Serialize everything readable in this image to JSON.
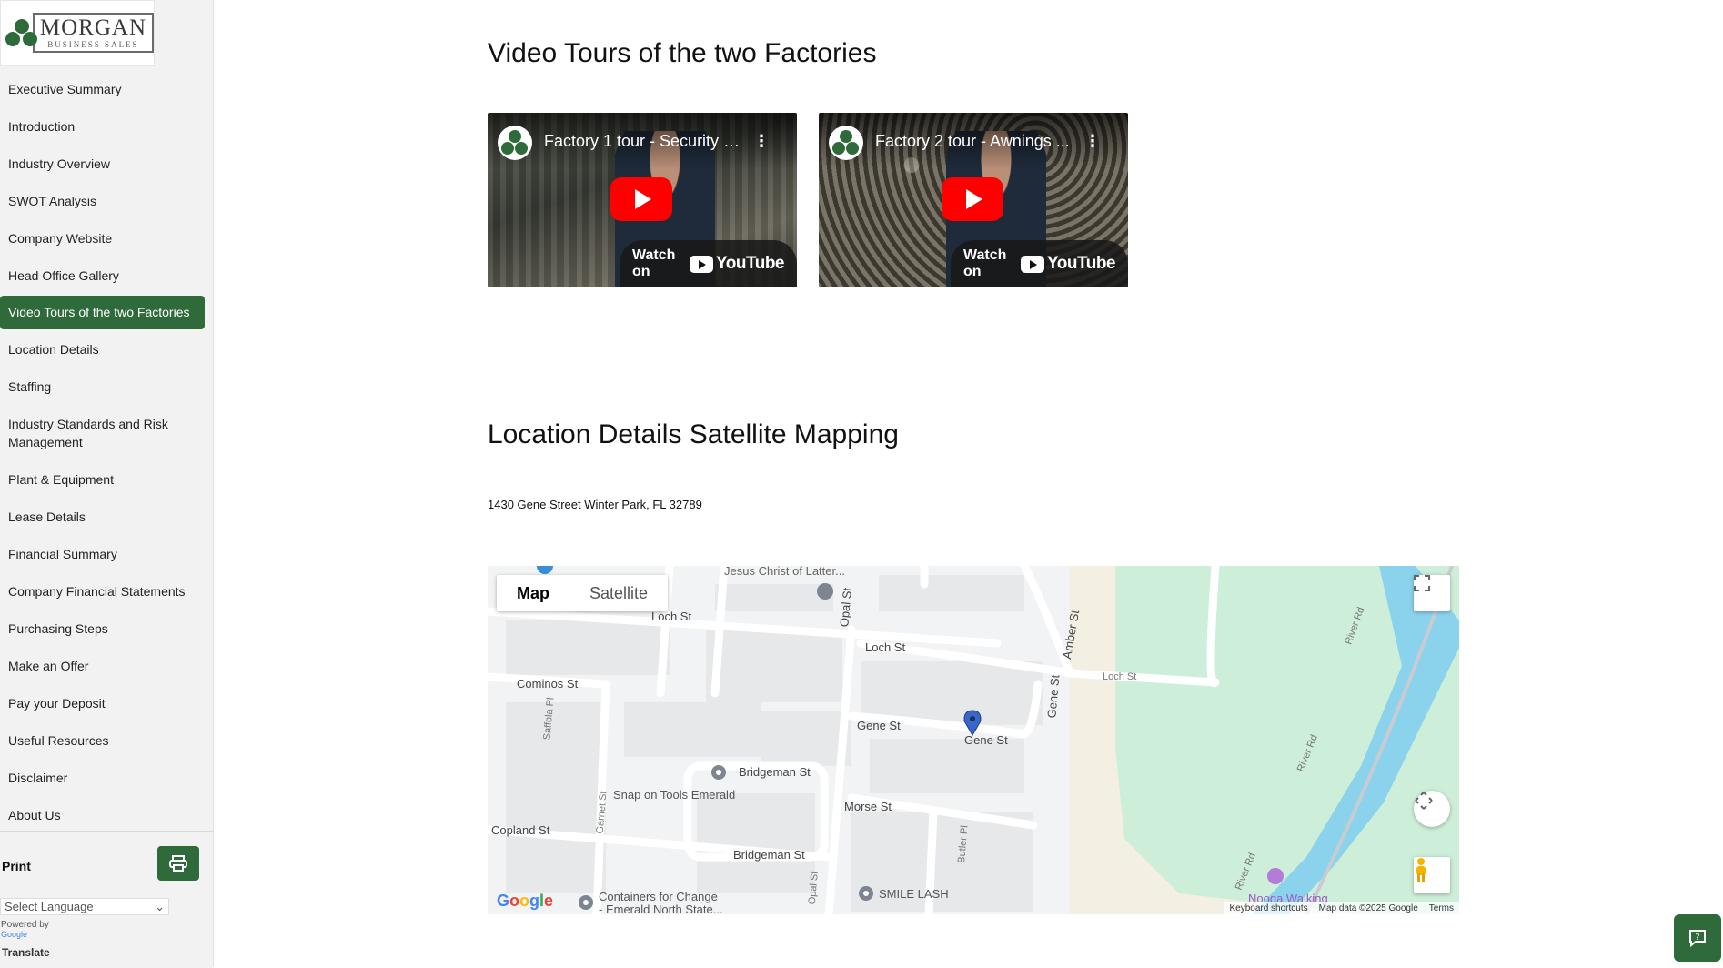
{
  "logo": {
    "title": "MORGAN",
    "subtitle": "BUSINESS SALES"
  },
  "sidebar": {
    "items": [
      {
        "label": "Executive Summary"
      },
      {
        "label": "Introduction"
      },
      {
        "label": "Industry Overview"
      },
      {
        "label": "SWOT Analysis"
      },
      {
        "label": "Company Website"
      },
      {
        "label": "Head Office Gallery"
      },
      {
        "label": "Video Tours of the two Factories"
      },
      {
        "label": "Location Details"
      },
      {
        "label": "Staffing"
      },
      {
        "label": "Industry Standards and Risk Management"
      },
      {
        "label": "Plant & Equipment"
      },
      {
        "label": "Lease Details"
      },
      {
        "label": "Financial Summary"
      },
      {
        "label": "Company Financial Statements"
      },
      {
        "label": "Purchasing Steps"
      },
      {
        "label": "Make an Offer"
      },
      {
        "label": "Pay your Deposit"
      },
      {
        "label": "Useful Resources"
      },
      {
        "label": "Disclaimer"
      },
      {
        "label": "About Us"
      }
    ],
    "active_index": 6,
    "print_label": "Print",
    "language_select": "Select Language",
    "powered_by": "Powered by",
    "google_label": "Google",
    "translate_label": "Translate"
  },
  "video_section": {
    "title": "Video Tours of the two Factories",
    "videos": [
      {
        "title": "Factory 1 tour - Security S...",
        "watch_label": "Watch on",
        "platform": "YouTube"
      },
      {
        "title": "Factory 2 tour - Awnings ...",
        "watch_label": "Watch on",
        "platform": "YouTube"
      }
    ]
  },
  "location_section": {
    "title": "Location Details Satellite Mapping",
    "address": "1430 Gene Street Winter Park, FL 32789"
  },
  "map": {
    "map_tab": "Map",
    "satellite_tab": "Satellite",
    "streets": [
      "Jesus Christ of Latter...",
      "Loch St",
      "Loch St",
      "Loch St",
      "Cominos St",
      "Gene St",
      "Gene St",
      "Gene St",
      "Bridgeman St",
      "Snap on Tools Emerald",
      "Morse St",
      "Copland St",
      "Bridgeman St",
      "Containers for Change",
      "- Emerald North State...",
      "SMILE LASH",
      "Opal St",
      "Amber St",
      "Saffola Pl",
      "Garnet St",
      "Butler Pl",
      "River Rd",
      "River Rd",
      "River Rd",
      "Nooga Walking",
      "Opal St"
    ],
    "footer": {
      "shortcuts": "Keyboard shortcuts",
      "data": "Map data ©2025 Google",
      "terms": "Terms"
    },
    "google_logo": "Google"
  },
  "colors": {
    "brand_green": "#2f6b3a",
    "youtube_red": "#ff0000",
    "water": "#8bd3ec",
    "park": "#cdeed9"
  }
}
